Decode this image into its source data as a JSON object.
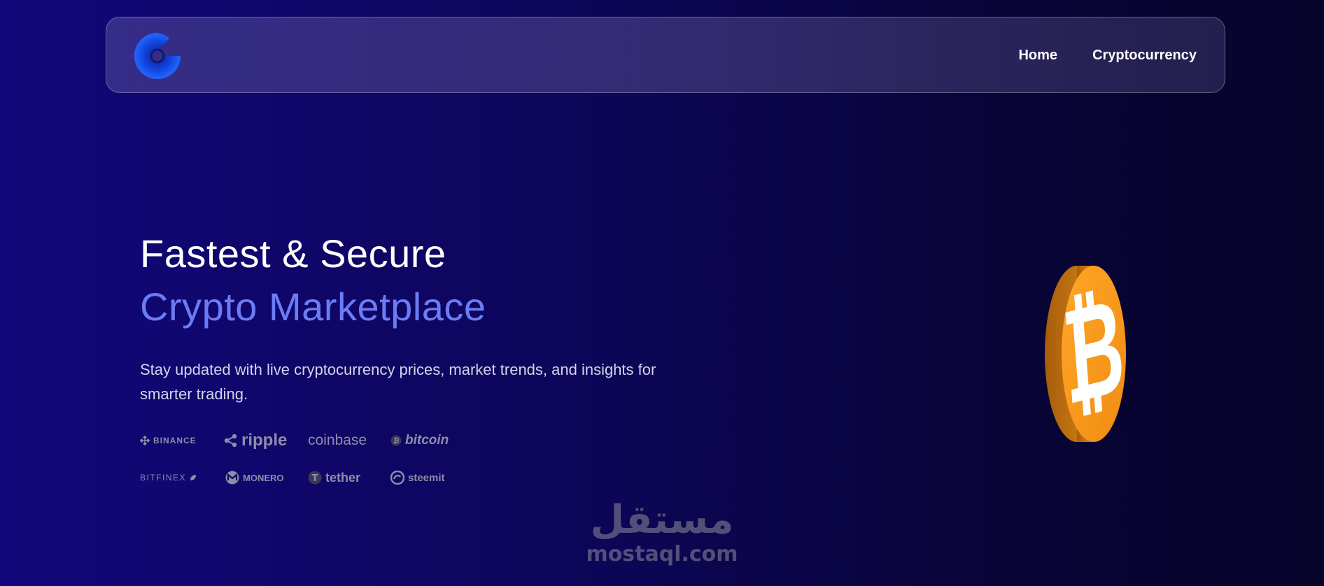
{
  "header": {
    "logo_icon": "c-ring-logo-icon",
    "nav": [
      {
        "label": "Home"
      },
      {
        "label": "Cryptocurrency"
      }
    ]
  },
  "hero": {
    "title_line1": "Fastest & Secure",
    "title_line2": "Crypto Marketplace",
    "description": "Stay updated with live cryptocurrency prices, market trends, and insights for smarter trading."
  },
  "partners": {
    "row1": [
      {
        "name": "BINANCE",
        "icon": "binance-icon"
      },
      {
        "name": "ripple",
        "icon": "ripple-icon"
      },
      {
        "name": "coinbase",
        "icon": ""
      },
      {
        "name": "bitcoin",
        "icon": "bitcoin-icon"
      }
    ],
    "row2": [
      {
        "name": "BITFINEX",
        "icon": "bitfinex-leaf-icon"
      },
      {
        "name": "MONERO",
        "icon": "monero-icon"
      },
      {
        "name": "tether",
        "icon": "tether-icon"
      },
      {
        "name": "steemit",
        "icon": "steemit-icon"
      }
    ]
  },
  "illustration": {
    "icon": "bitcoin-coin-3d-icon"
  },
  "watermark": {
    "arabic": "مستقل",
    "latin": "mostaql.com"
  },
  "colors": {
    "background": "#0d0658",
    "accent": "#6c7cf4",
    "logo_blue": "#1d5fff",
    "coin_orange": "#f7931a"
  }
}
